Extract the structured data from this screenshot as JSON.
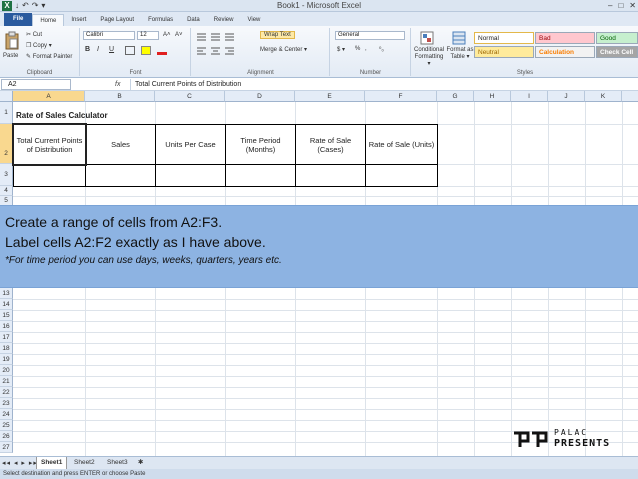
{
  "window": {
    "title": "Book1 - Microsoft Excel",
    "app_icon": "X",
    "qat": [
      "↓",
      "↶",
      "↷",
      "▾"
    ],
    "controls": [
      "–",
      "□",
      "✕"
    ]
  },
  "ribbon": {
    "tabs": [
      "File",
      "Home",
      "Insert",
      "Page Layout",
      "Formulas",
      "Data",
      "Review",
      "View"
    ],
    "clipboard": {
      "paste": "Paste",
      "cut": "Cut",
      "copy": "Copy ▾",
      "format_painter": "Format Painter",
      "label": "Clipboard"
    },
    "font": {
      "name": "Calibri",
      "size": "12",
      "bold": "B",
      "italic": "I",
      "underline": "U",
      "grow": "A˄",
      "shrink": "A˅",
      "label": "Font"
    },
    "alignment": {
      "wrap_text": "Wrap Text",
      "merge": "Merge & Center ▾",
      "label": "Alignment"
    },
    "number": {
      "format": "General",
      "currency": "$ ▾",
      "percent": "%",
      "comma": ",",
      "inc_dec": "⁰₀",
      "label": "Number"
    },
    "styles": {
      "conditional": "Conditional Formatting ▾",
      "format_as_table": "Format as Table ▾",
      "normal": "Normal",
      "bad": "Bad",
      "good": "Good",
      "neutral": "Neutral",
      "calculation": "Calculation",
      "check_cell": "Check Cell",
      "label": "Styles"
    }
  },
  "formula_bar": {
    "name_box": "A2",
    "fx": "fx",
    "content": "Total Current Points of Distribution"
  },
  "grid": {
    "columns": [
      "A",
      "B",
      "C",
      "D",
      "E",
      "F",
      "G",
      "H",
      "I",
      "J",
      "K"
    ],
    "rows": [
      "1",
      "2",
      "3",
      "4",
      "5",
      "13",
      "14",
      "15",
      "16",
      "17",
      "18",
      "19",
      "20",
      "21",
      "22",
      "23",
      "24",
      "25",
      "26",
      "27"
    ],
    "title": "Rate of Sales Calculator",
    "headers": [
      "Total Current Points of Distribution",
      "Sales",
      "Units Per Case",
      "Time Period (Months)",
      "Rate of Sale (Cases)",
      "Rate of Sale (Units)"
    ]
  },
  "banner": {
    "line1": "Create a range of cells from A2:F3.",
    "line2": "Label cells A2:F2 exactly as I have above.",
    "note": "*For time period you can use days, weeks, quarters, years etc."
  },
  "sheets": {
    "nav": "◂◂ ◂ ▸ ▸▸",
    "tabs": [
      "Sheet1",
      "Sheet2",
      "Sheet3"
    ],
    "new_sheet": "✱"
  },
  "status": "Select destination and press ENTER or choose Paste",
  "logo": {
    "line1": "PALAC",
    "line2": "PRESENTS"
  },
  "colors": {
    "banner": "#8db3e2",
    "header_fill": "#e4ecf7",
    "selected_header": "#f9d88f",
    "file_tab": "#2a5a9e"
  }
}
